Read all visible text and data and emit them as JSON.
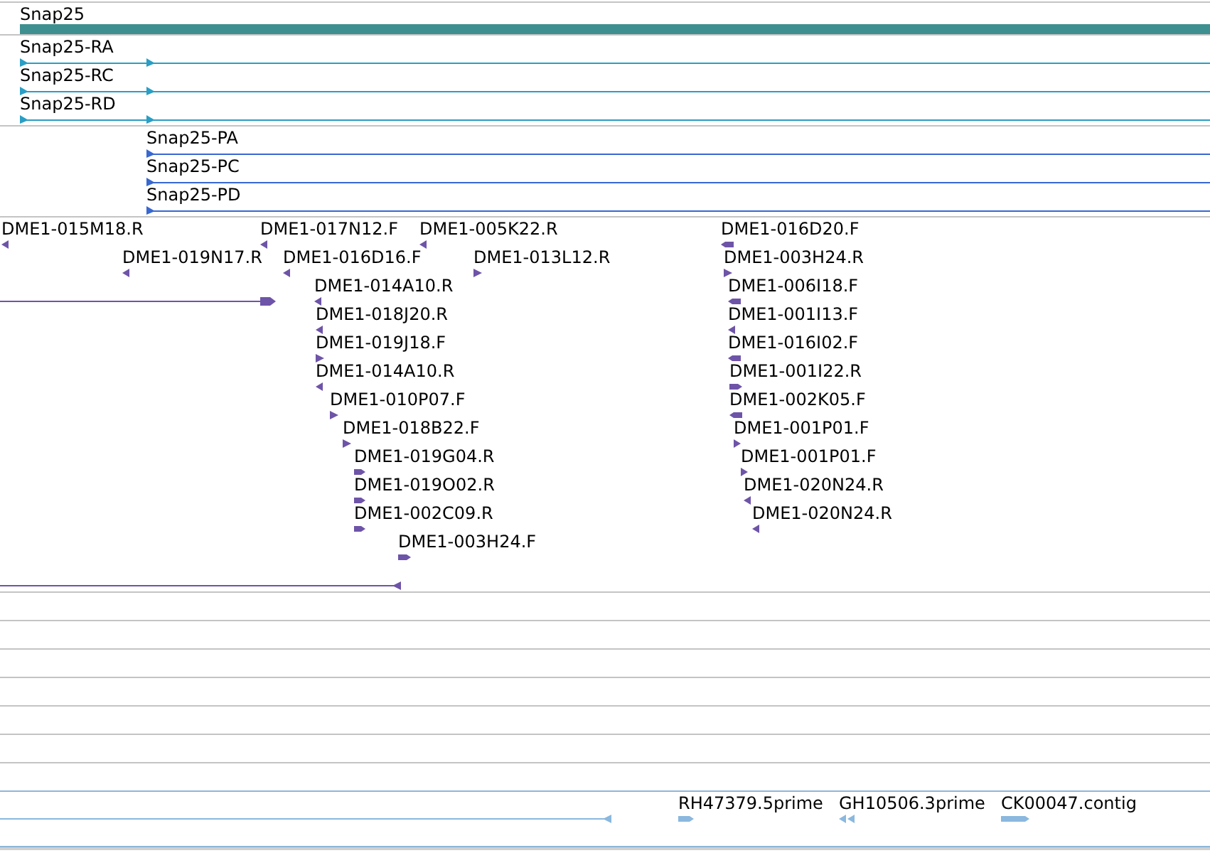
{
  "tracks": [
    {
      "kind": "gene",
      "features": [
        {
          "label": "Snap25"
        }
      ]
    },
    {
      "kind": "transcript",
      "features": [
        {
          "label": "Snap25-RA"
        },
        {
          "label": "Snap25-RC"
        },
        {
          "label": "Snap25-RD"
        }
      ]
    },
    {
      "kind": "protein",
      "features": [
        {
          "label": "Snap25-PA"
        },
        {
          "label": "Snap25-PC"
        },
        {
          "label": "Snap25-PD"
        }
      ]
    },
    {
      "kind": "reads",
      "features": [
        {
          "kind": "read",
          "label": "DME1-015M18.R",
          "reverse": true
        },
        {
          "kind": "read",
          "label": "DME1-017N12.F",
          "reverse": true
        },
        {
          "kind": "read",
          "label": "DME1-005K22.R",
          "reverse": true
        },
        {
          "kind": "read",
          "label": "DME1-016D20.F",
          "reverse": true
        },
        {
          "kind": "read",
          "label": "DME1-019N17.R",
          "reverse": true
        },
        {
          "kind": "read",
          "label": "DME1-016D16.F",
          "reverse": true
        },
        {
          "kind": "read",
          "label": "DME1-013L12.R",
          "reverse": false
        },
        {
          "kind": "read",
          "label": "DME1-003H24.R",
          "reverse": false
        },
        {
          "kind": "span",
          "reverse": false
        },
        {
          "kind": "read",
          "label": "DME1-014A10.R",
          "reverse": true
        },
        {
          "kind": "read",
          "label": "DME1-006I18.F",
          "reverse": true
        },
        {
          "kind": "read",
          "label": "DME1-018J20.R",
          "reverse": true
        },
        {
          "kind": "read",
          "label": "DME1-001I13.F",
          "reverse": true
        },
        {
          "kind": "read",
          "label": "DME1-019J18.F",
          "reverse": false
        },
        {
          "kind": "read",
          "label": "DME1-016I02.F",
          "reverse": true
        },
        {
          "kind": "read",
          "label": "DME1-014A10.R",
          "reverse": true
        },
        {
          "kind": "read",
          "label": "DME1-001I22.R",
          "reverse": false
        },
        {
          "kind": "read",
          "label": "DME1-010P07.F",
          "reverse": false
        },
        {
          "kind": "read",
          "label": "DME1-002K05.F",
          "reverse": true
        },
        {
          "kind": "read",
          "label": "DME1-018B22.F",
          "reverse": false
        },
        {
          "kind": "read",
          "label": "DME1-001P01.F",
          "reverse": false
        },
        {
          "kind": "read",
          "label": "DME1-019G04.R",
          "reverse": false
        },
        {
          "kind": "read",
          "label": "DME1-001P01.F",
          "reverse": false
        },
        {
          "kind": "read",
          "label": "DME1-019O02.R",
          "reverse": false
        },
        {
          "kind": "read",
          "label": "DME1-020N24.R",
          "reverse": true
        },
        {
          "kind": "read",
          "label": "DME1-002C09.R",
          "reverse": false
        },
        {
          "kind": "read",
          "label": "DME1-020N24.R",
          "reverse": true
        },
        {
          "kind": "read",
          "label": "DME1-003H24.F",
          "reverse": false
        },
        {
          "kind": "span",
          "reverse": true
        }
      ]
    },
    {
      "kind": "empty"
    },
    {
      "kind": "empty"
    },
    {
      "kind": "empty"
    },
    {
      "kind": "empty"
    },
    {
      "kind": "empty"
    },
    {
      "kind": "empty"
    },
    {
      "kind": "empty"
    },
    {
      "kind": "cdna",
      "features": [
        {
          "kind": "span",
          "reverse": true
        },
        {
          "kind": "read",
          "label": "RH47379.5prime",
          "reverse": false
        },
        {
          "kind": "pair",
          "label": "GH10506.3prime",
          "reverse": true
        },
        {
          "kind": "read",
          "label": "CK00047.contig",
          "reverse": false
        }
      ]
    }
  ]
}
